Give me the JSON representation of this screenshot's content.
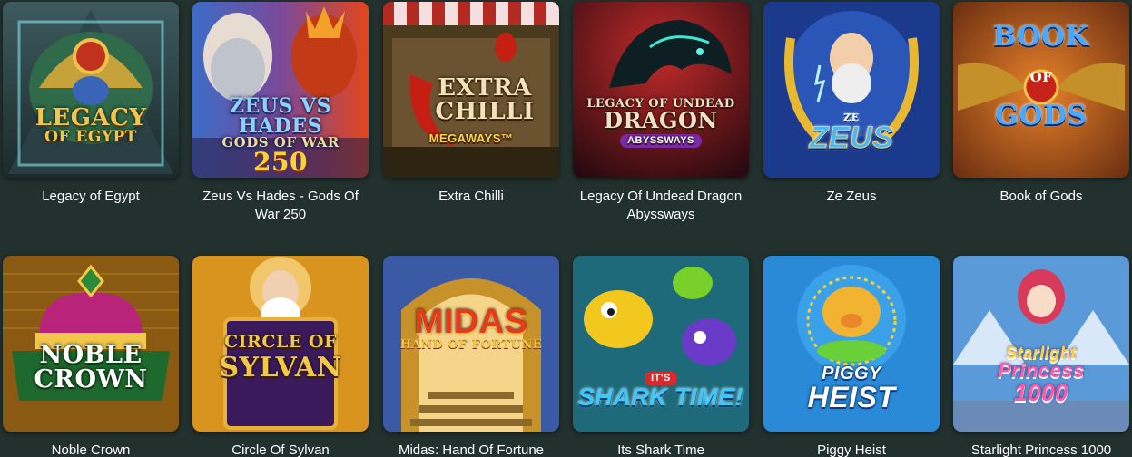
{
  "games": [
    {
      "title": "Legacy of Egypt",
      "logo": [
        "LEGACY",
        "OF EGYPT"
      ]
    },
    {
      "title": "Zeus Vs Hades - Gods Of War 250",
      "logo": [
        "ZEUS VS HADES",
        "GODS OF WAR",
        "250"
      ]
    },
    {
      "title": "Extra Chilli",
      "logo": [
        "EXTRA",
        "CHILLI",
        "MEGAWAYS™"
      ]
    },
    {
      "title": "Legacy Of Undead Dragon Abyssways",
      "logo": [
        "LEGACY OF UNDEAD",
        "DRAGON",
        "ABYSSWAYS"
      ]
    },
    {
      "title": "Ze Zeus",
      "logo": [
        "ZE",
        "ZEUS"
      ]
    },
    {
      "title": "Book of Gods",
      "logo": [
        "BOOK",
        "OF",
        "GODS"
      ]
    },
    {
      "title": "Noble Crown",
      "logo": [
        "NOBLE",
        "CROWN"
      ]
    },
    {
      "title": "Circle Of Sylvan",
      "logo": [
        "CIRCLE OF",
        "SYLVAN"
      ]
    },
    {
      "title": "Midas: Hand Of Fortune",
      "logo": [
        "MIDAS",
        "HAND OF FORTUNE"
      ]
    },
    {
      "title": "Its Shark Time",
      "logo": [
        "IT'S",
        "SHARK TIME!"
      ]
    },
    {
      "title": "Piggy Heist",
      "logo": [
        "PIGGY",
        "HEIST"
      ]
    },
    {
      "title": "Starlight Princess 1000",
      "logo": [
        "Starlight",
        "Princess",
        "1000"
      ]
    }
  ],
  "colors": {
    "page_background": "#22302e",
    "title_text": "#ffffff"
  }
}
